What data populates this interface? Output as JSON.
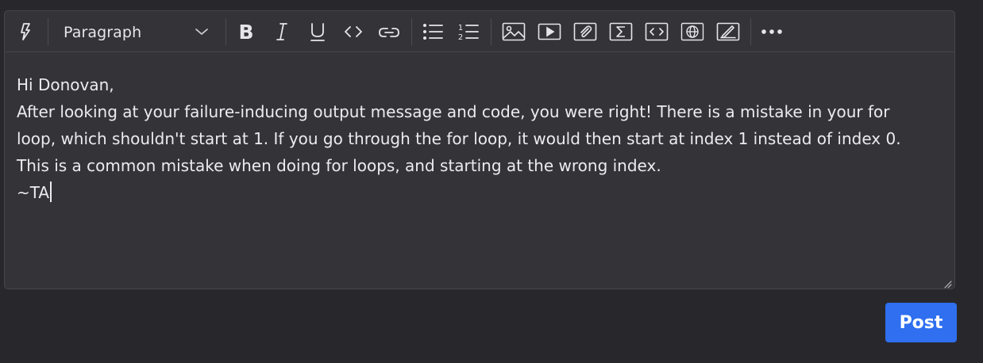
{
  "toolbar": {
    "block_format": "Paragraph",
    "icons": [
      "lightning-icon",
      "bold-icon",
      "italic-icon",
      "underline-icon",
      "inline-code-icon",
      "link-icon",
      "bullet-list-icon",
      "numbered-list-icon",
      "image-icon",
      "video-icon",
      "attachment-icon",
      "math-icon",
      "code-block-icon",
      "embed-icon",
      "drawing-icon",
      "more-icon"
    ]
  },
  "editor": {
    "lines": [
      "Hi Donovan,",
      "After looking at your failure-inducing output message and code, you were right! There is a mistake in your for",
      "loop, which shouldn't start at 1. If you go through the for loop, it would then start at index 1 instead of index 0.",
      "This is a common mistake when doing for loops, and starting at the wrong index.",
      "~TA"
    ]
  },
  "actions": {
    "post_label": "Post"
  },
  "colors": {
    "background": "#28282c",
    "editor_bg": "#343438",
    "accent": "#2f6ff0",
    "text": "#ececee"
  }
}
